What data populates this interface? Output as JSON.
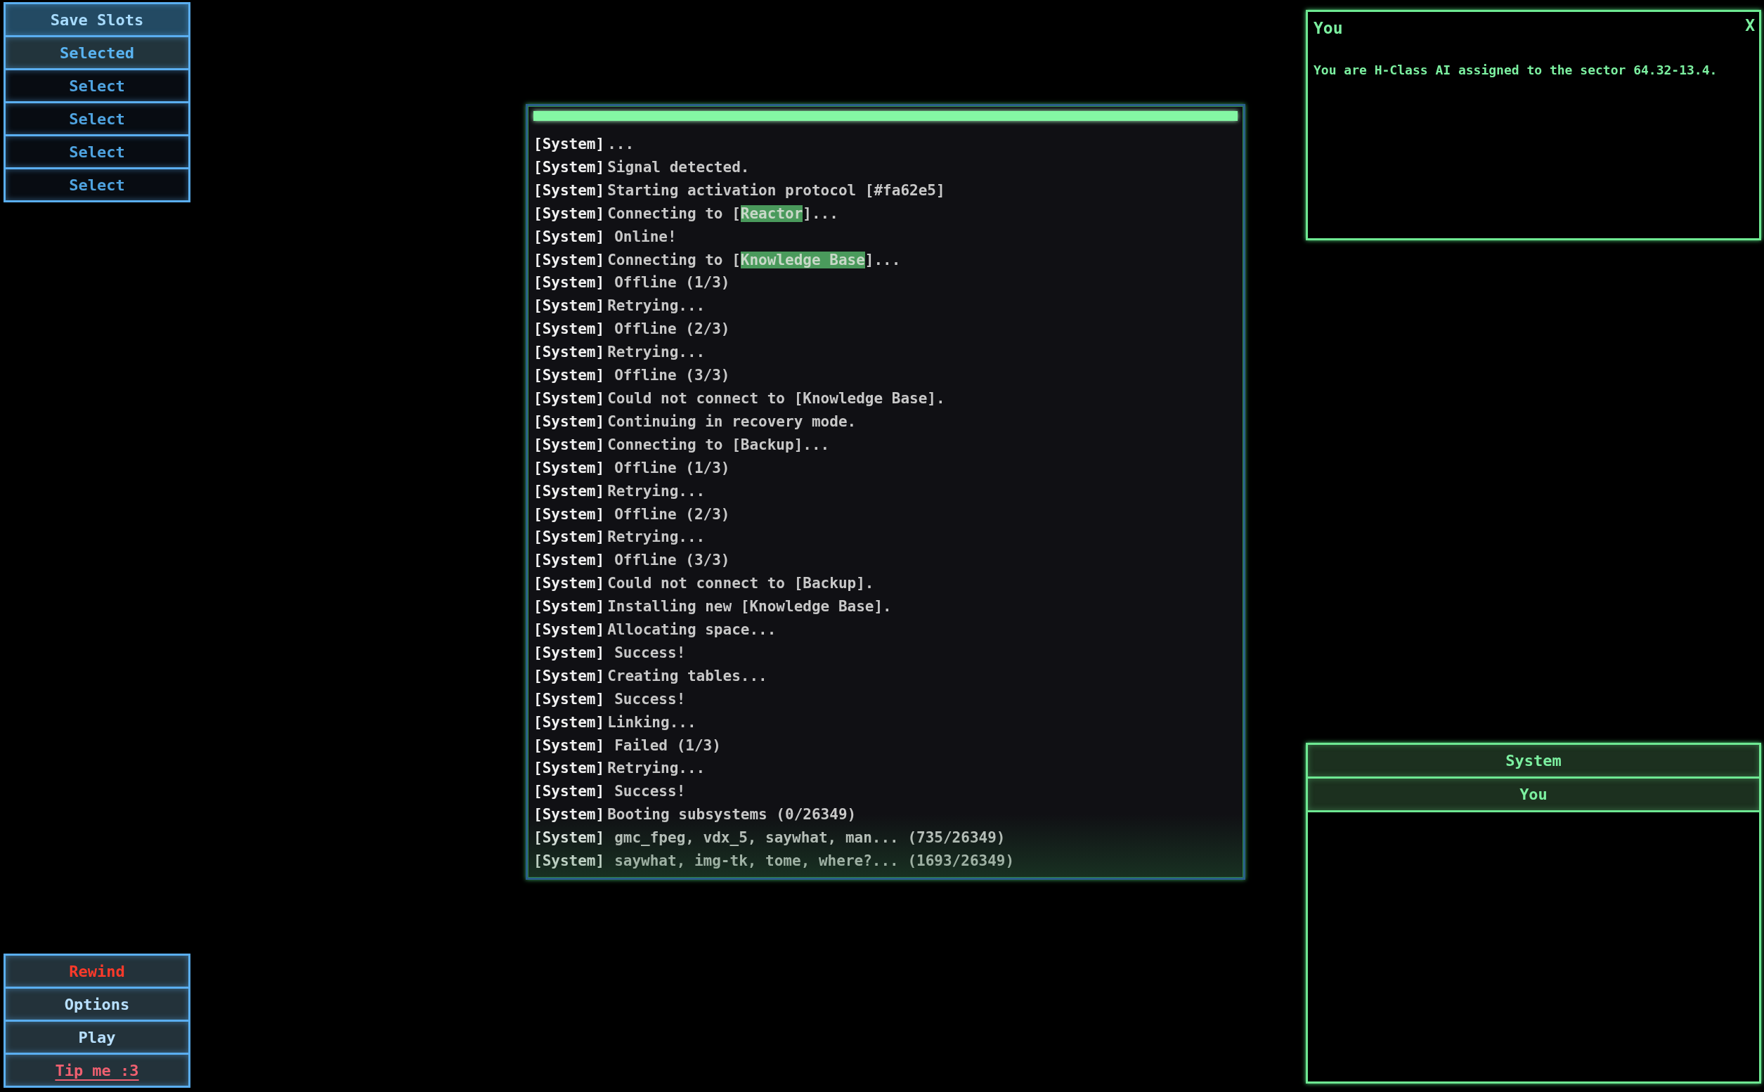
{
  "save_slots": {
    "title": "Save Slots",
    "slots": [
      {
        "label": "Selected",
        "selected": true
      },
      {
        "label": "Select",
        "selected": false
      },
      {
        "label": "Select",
        "selected": false
      },
      {
        "label": "Select",
        "selected": false
      },
      {
        "label": "Select",
        "selected": false
      }
    ]
  },
  "menu": [
    {
      "label": "Rewind",
      "kind": "danger"
    },
    {
      "label": "Options",
      "kind": "normal"
    },
    {
      "label": "Play",
      "kind": "normal"
    },
    {
      "label": "Tip me :3",
      "kind": "link"
    }
  ],
  "terminal": {
    "progress": {
      "level": 1
    },
    "lines": [
      {
        "speaker": "[System]",
        "kind": "system",
        "indented": false,
        "parts": [
          {
            "text": "...",
            "highlight": false
          }
        ]
      },
      {
        "speaker": "[System]",
        "kind": "system",
        "indented": false,
        "parts": [
          {
            "text": "Signal detected.",
            "highlight": false
          }
        ]
      },
      {
        "speaker": "[System]",
        "kind": "system",
        "indented": false,
        "parts": [
          {
            "text": "Starting activation protocol [#fa62e5]",
            "highlight": false
          }
        ]
      },
      {
        "speaker": "[System]",
        "kind": "system",
        "indented": false,
        "parts": [
          {
            "text": "Connecting to [",
            "highlight": false
          },
          {
            "text": "Reactor",
            "highlight": true
          },
          {
            "text": "]...",
            "highlight": false
          }
        ]
      },
      {
        "speaker": "[System]",
        "kind": "system",
        "indented": true,
        "parts": [
          {
            "text": "Online!",
            "highlight": false
          }
        ]
      },
      {
        "speaker": "[System]",
        "kind": "system",
        "indented": false,
        "parts": [
          {
            "text": "Connecting to [",
            "highlight": false
          },
          {
            "text": "Knowledge Base",
            "highlight": true
          },
          {
            "text": "]...",
            "highlight": false
          }
        ]
      },
      {
        "speaker": "[System]",
        "kind": "system",
        "indented": true,
        "parts": [
          {
            "text": "Offline (1/3)",
            "highlight": false
          }
        ]
      },
      {
        "speaker": "[System]",
        "kind": "system",
        "indented": false,
        "parts": [
          {
            "text": "Retrying...",
            "highlight": false
          }
        ]
      },
      {
        "speaker": "[System]",
        "kind": "system",
        "indented": true,
        "parts": [
          {
            "text": "Offline (2/3)",
            "highlight": false
          }
        ]
      },
      {
        "speaker": "[System]",
        "kind": "system",
        "indented": false,
        "parts": [
          {
            "text": "Retrying...",
            "highlight": false
          }
        ]
      },
      {
        "speaker": "[System]",
        "kind": "system",
        "indented": true,
        "parts": [
          {
            "text": "Offline (3/3)",
            "highlight": false
          }
        ]
      },
      {
        "speaker": "[System]",
        "kind": "system",
        "indented": false,
        "parts": [
          {
            "text": "Could not connect to [Knowledge Base].",
            "highlight": false
          }
        ]
      },
      {
        "speaker": "[System]",
        "kind": "system",
        "indented": false,
        "parts": [
          {
            "text": "Continuing in recovery mode.",
            "highlight": false
          }
        ]
      },
      {
        "speaker": "[System]",
        "kind": "system",
        "indented": false,
        "parts": [
          {
            "text": "Connecting to [Backup]...",
            "highlight": false
          }
        ]
      },
      {
        "speaker": "[System]",
        "kind": "system",
        "indented": true,
        "parts": [
          {
            "text": "Offline (1/3)",
            "highlight": false
          }
        ]
      },
      {
        "speaker": "[System]",
        "kind": "system",
        "indented": false,
        "parts": [
          {
            "text": "Retrying...",
            "highlight": false
          }
        ]
      },
      {
        "speaker": "[System]",
        "kind": "system",
        "indented": true,
        "parts": [
          {
            "text": "Offline (2/3)",
            "highlight": false
          }
        ]
      },
      {
        "speaker": "[System]",
        "kind": "system",
        "indented": false,
        "parts": [
          {
            "text": "Retrying...",
            "highlight": false
          }
        ]
      },
      {
        "speaker": "[System]",
        "kind": "system",
        "indented": true,
        "parts": [
          {
            "text": "Offline (3/3)",
            "highlight": false
          }
        ]
      },
      {
        "speaker": "[System]",
        "kind": "system",
        "indented": false,
        "parts": [
          {
            "text": "Could not connect to [Backup].",
            "highlight": false
          }
        ]
      },
      {
        "speaker": "[System]",
        "kind": "system",
        "indented": false,
        "parts": [
          {
            "text": "Installing new [Knowledge Base].",
            "highlight": false
          }
        ]
      },
      {
        "speaker": "[System]",
        "kind": "system",
        "indented": false,
        "parts": [
          {
            "text": "Allocating space...",
            "highlight": false
          }
        ]
      },
      {
        "speaker": "[System]",
        "kind": "system",
        "indented": true,
        "parts": [
          {
            "text": "Success!",
            "highlight": false
          }
        ]
      },
      {
        "speaker": "[System]",
        "kind": "system",
        "indented": false,
        "parts": [
          {
            "text": "Creating tables...",
            "highlight": false
          }
        ]
      },
      {
        "speaker": "[System]",
        "kind": "system",
        "indented": true,
        "parts": [
          {
            "text": "Success!",
            "highlight": false
          }
        ]
      },
      {
        "speaker": "[System]",
        "kind": "system",
        "indented": false,
        "parts": [
          {
            "text": "Linking...",
            "highlight": false
          }
        ]
      },
      {
        "speaker": "[System]",
        "kind": "system",
        "indented": true,
        "parts": [
          {
            "text": "Failed (1/3)",
            "highlight": false
          }
        ]
      },
      {
        "speaker": "[System]",
        "kind": "system",
        "indented": false,
        "parts": [
          {
            "text": "Retrying...",
            "highlight": false
          }
        ]
      },
      {
        "speaker": "[System]",
        "kind": "system",
        "indented": true,
        "parts": [
          {
            "text": "Success!",
            "highlight": false
          }
        ]
      },
      {
        "speaker": "[System]",
        "kind": "system",
        "indented": false,
        "parts": [
          {
            "text": "Booting subsystems (0/26349)",
            "highlight": false
          }
        ]
      },
      {
        "speaker": "[System]",
        "kind": "system",
        "indented": true,
        "parts": [
          {
            "text": "gmc_fpeg, vdx_5, saywhat, man... (735/26349)",
            "highlight": false
          }
        ]
      },
      {
        "speaker": "[System]",
        "kind": "system",
        "indented": true,
        "parts": [
          {
            "text": "saywhat, img-tk, tome, where?... (1693/26349)",
            "highlight": false
          }
        ]
      }
    ]
  },
  "dialog": {
    "title": "You",
    "close": "X",
    "message": "You are H-Class AI assigned to the sector 64.32-13.4."
  },
  "channels": {
    "tabs": [
      {
        "label": "System"
      },
      {
        "label": "You"
      }
    ]
  }
}
